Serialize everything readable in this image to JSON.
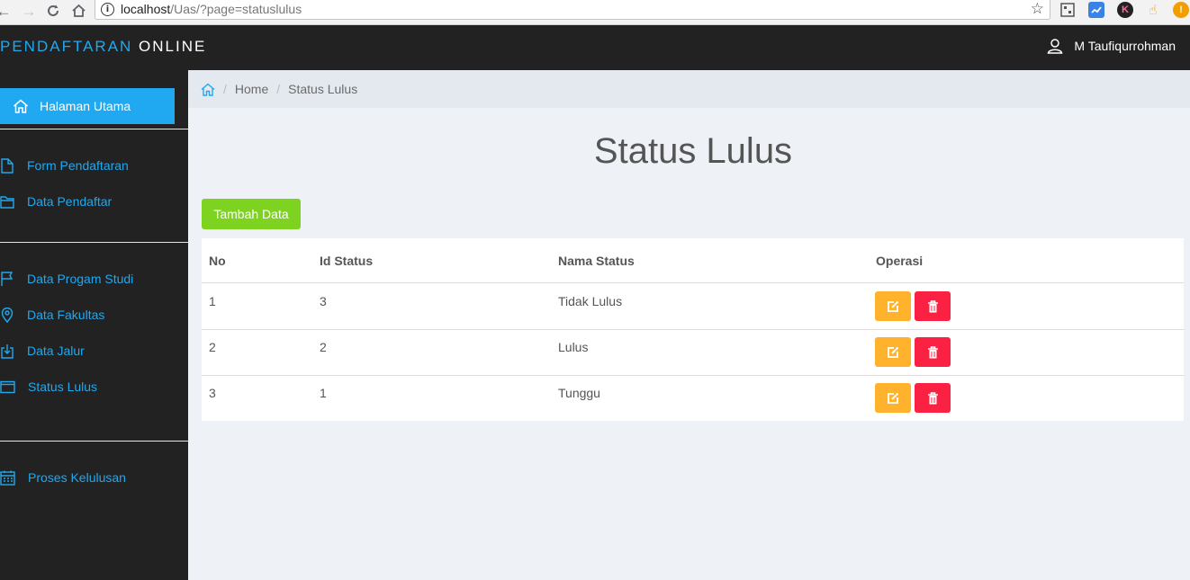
{
  "browser": {
    "url_host": "localhost",
    "url_path": "/Uas/?page=statuslulus",
    "ext_badge": "K"
  },
  "navbar": {
    "brand_part1": "PENDAFTARAN",
    "brand_part2": "ONLINE",
    "user_name": "M Taufiqurrohman"
  },
  "sidebar": {
    "active_item": "Halaman Utama",
    "items": [
      {
        "label": "Form Pendaftaran",
        "icon": "file-icon"
      },
      {
        "label": "Data Pendaftar",
        "icon": "folder-icon"
      },
      {
        "label": "Data Progam Studi",
        "icon": "flag-icon"
      },
      {
        "label": "Data Fakultas",
        "icon": "location-pin-icon"
      },
      {
        "label": "Data Jalur",
        "icon": "download-icon"
      },
      {
        "label": "Status Lulus",
        "icon": "window-icon"
      },
      {
        "label": "Proses Kelulusan",
        "icon": "calendar-icon"
      }
    ]
  },
  "breadcrumb": {
    "home": "Home",
    "current": "Status Lulus"
  },
  "main": {
    "title": "Status Lulus",
    "add_button": "Tambah Data"
  },
  "table": {
    "headers": [
      "No",
      "Id Status",
      "Nama Status",
      "Operasi"
    ],
    "rows": [
      [
        "1",
        "3",
        "Tidak Lulus"
      ],
      [
        "2",
        "2",
        "Lulus"
      ],
      [
        "3",
        "1",
        "Tunggu"
      ]
    ]
  },
  "colors": {
    "accent": "#20a8f0",
    "navbar_bg": "#222222",
    "add_button": "#7ed321",
    "edit_button": "#ffb22b",
    "delete_button": "#fb2142"
  }
}
